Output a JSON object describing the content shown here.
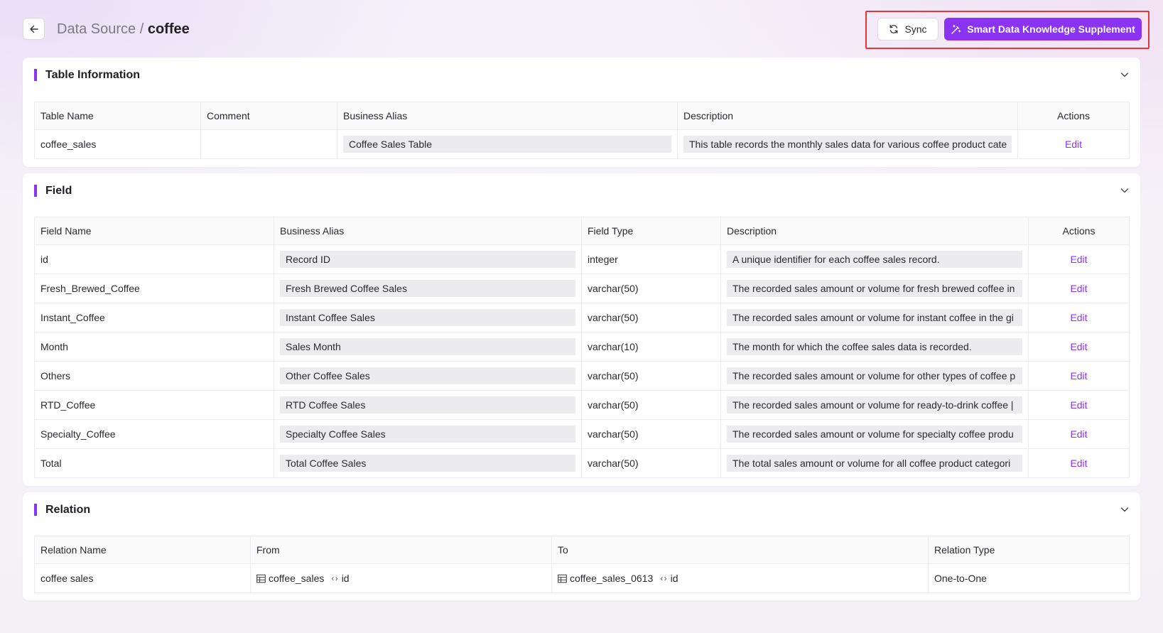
{
  "header": {
    "back_icon": "arrow-left-icon",
    "breadcrumb_parent": "Data Source",
    "breadcrumb_separator": " / ",
    "breadcrumb_current": "coffee",
    "sync_label": "Sync",
    "sync_icon": "refresh-icon",
    "smart_label": "Smart Data Knowledge Supplement",
    "smart_icon": "magic-wand-icon",
    "accent": "#8a33f2",
    "highlight_border": "#e4363a"
  },
  "table_info": {
    "title": "Table Information",
    "columns": [
      "Table Name",
      "Comment",
      "Business Alias",
      "Description",
      "Actions"
    ],
    "row": {
      "name": "coffee_sales",
      "comment": "",
      "alias": "Coffee Sales Table",
      "description": "This table records the monthly sales data for various coffee product cate",
      "action": "Edit"
    }
  },
  "field": {
    "title": "Field",
    "columns": [
      "Field Name",
      "Business Alias",
      "Field Type",
      "Description",
      "Actions"
    ],
    "rows": [
      {
        "name": "id",
        "alias": "Record ID",
        "type": "integer",
        "description": "A unique identifier for each coffee sales record.",
        "action": "Edit"
      },
      {
        "name": "Fresh_Brewed_Coffee",
        "alias": "Fresh Brewed Coffee Sales",
        "type": "varchar(50)",
        "description": "The recorded sales amount or volume for fresh brewed coffee in",
        "action": "Edit"
      },
      {
        "name": "Instant_Coffee",
        "alias": "Instant Coffee Sales",
        "type": "varchar(50)",
        "description": "The recorded sales amount or volume for instant coffee in the gi",
        "action": "Edit"
      },
      {
        "name": "Month",
        "alias": "Sales Month",
        "type": "varchar(10)",
        "description": "The month for which the coffee sales data is recorded.",
        "action": "Edit"
      },
      {
        "name": "Others",
        "alias": "Other Coffee Sales",
        "type": "varchar(50)",
        "description": "The recorded sales amount or volume for other types of coffee p",
        "action": "Edit"
      },
      {
        "name": "RTD_Coffee",
        "alias": "RTD Coffee Sales",
        "type": "varchar(50)",
        "description": "The recorded sales amount or volume for ready-to-drink coffee |",
        "action": "Edit"
      },
      {
        "name": "Specialty_Coffee",
        "alias": "Specialty Coffee Sales",
        "type": "varchar(50)",
        "description": "The recorded sales amount or volume for specialty coffee produ",
        "action": "Edit"
      },
      {
        "name": "Total",
        "alias": "Total Coffee Sales",
        "type": "varchar(50)",
        "description": "The total sales amount or volume for all coffee product categori",
        "action": "Edit"
      }
    ]
  },
  "relation": {
    "title": "Relation",
    "columns": [
      "Relation Name",
      "From",
      "To",
      "Relation Type"
    ],
    "rows": [
      {
        "name": "coffee sales",
        "from_table": "coffee_sales",
        "from_field": "id",
        "to_table": "coffee_sales_0613",
        "to_field": "id",
        "type": "One-to-One"
      }
    ]
  }
}
